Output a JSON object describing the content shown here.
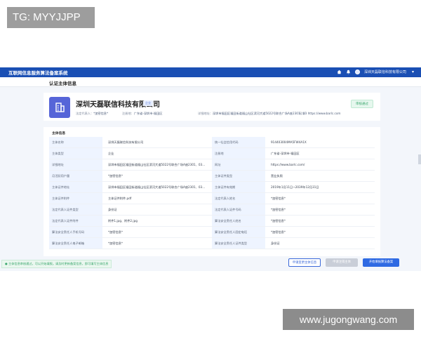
{
  "watermark_top": "TG: MYYJJPP",
  "watermark_bottom": "www.jugongwang.com",
  "topbar": {
    "title": "互联网信息服务算法备案系统",
    "icons": [
      "home-icon",
      "bell-icon"
    ],
    "user": "深圳天磊联信科技有限公司"
  },
  "subheader": {
    "label": "认证主体信息"
  },
  "company": {
    "name": "深圳天磊联信科技有限公司",
    "tag": "企业",
    "status": "审核通过",
    "meta": {
      "legal_label": "法定代表人：",
      "legal_value": "*加密信息*",
      "reg_label": "注册地：",
      "reg_value": "广东省-深圳市-福田区",
      "addr_label": "详细地址：",
      "addr_value": "深圳市福田区福田街道福山社区滨河大道5022号联合广场A座2301、03",
      "site_label": "网址：",
      "site_value": "https://www.barlc.com"
    }
  },
  "info": {
    "title": "主体信息",
    "rows": [
      {
        "l1": "主体名称",
        "v1": "深圳天磊联信科技有限公司",
        "l2": "统一社会信用代码",
        "v2": "914403004MA5FW4A1X"
      },
      {
        "l1": "主体类型",
        "v1": "企业",
        "l2": "注册地",
        "v2": "广东省-深圳市-福田区"
      },
      {
        "l1": "详细地址",
        "v1": "深圳市福田区福田街道福山社区滨河大道5022号联合广场A座2301、03...",
        "l2": "网址",
        "v2": "https://www.barlc.com/"
      },
      {
        "l1": "月活跃用户量",
        "v1": "*加密信息*",
        "l2": "主体证件类型",
        "v2": "营业执照"
      },
      {
        "l1": "主体证件地址",
        "v1": "深圳市福田区福田街道福山社区滨河大道5022号联合广场A座2301、03...",
        "l2": "主体证件有效期",
        "v2": "2019年1月11日~2039年12月31日"
      },
      {
        "l1": "主体证件附件",
        "v1": "主体证件附件.pdf",
        "l2": "法定代表人姓名",
        "v2": "*加密信息*"
      },
      {
        "l1": "法定代表人证件类型",
        "v1": "身份证",
        "l2": "法定代表人证件号码",
        "v2": "*加密信息*"
      },
      {
        "l1": "法定代表人证件附件",
        "v1": "附件1.jpg、附件2.jpg",
        "l2": "算法安全责任人姓名",
        "v2": "*加密信息*"
      },
      {
        "l1": "算法安全责任人手机号码",
        "v1": "*加密信息*",
        "l2": "算法安全责任人固定电话",
        "v2": "*加密信息*"
      },
      {
        "l1": "算法安全责任人电子邮箱",
        "v1": "*加密信息*",
        "l2": "算法安全责任人证件类型",
        "v2": "身份证"
      }
    ]
  },
  "footer": {
    "note": "主体信息审核通过，可以开始填报。请及时更新备案信息，即可填写主体信息",
    "btn_apply": "申请变更主体信息",
    "btn_disabled": "申请注销主体",
    "btn_primary": "开始填报算法备案"
  },
  "colors": {
    "brand": "#1a4fb4",
    "primary": "#2f6ae3",
    "success": "#3aa76d",
    "logo": "#5665d8"
  }
}
